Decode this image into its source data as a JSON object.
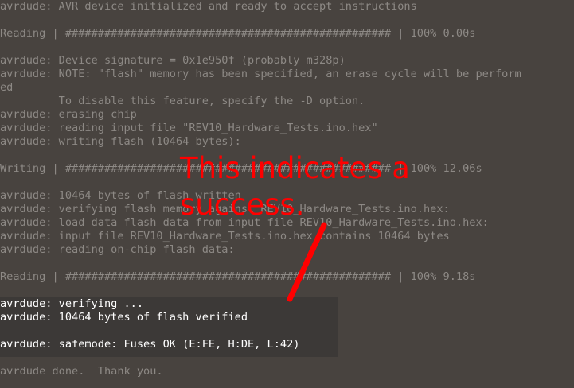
{
  "terminal": {
    "lines": [
      "avrdude: AVR device initialized and ready to accept instructions",
      "",
      "Reading | ################################################## | 100% 0.00s",
      "",
      "avrdude: Device signature = 0x1e950f (probably m328p)",
      "avrdude: NOTE: \"flash\" memory has been specified, an erase cycle will be perform",
      "ed",
      "         To disable this feature, specify the -D option.",
      "avrdude: erasing chip",
      "avrdude: reading input file \"REV10_Hardware_Tests.ino.hex\"",
      "avrdude: writing flash (10464 bytes):",
      "",
      "Writing | ################################################## | 100% 12.06s",
      "",
      "avrdude: 10464 bytes of flash written",
      "avrdude: verifying flash memory against REV10_Hardware_Tests.ino.hex:",
      "avrdude: load data flash data from input file REV10_Hardware_Tests.ino.hex:",
      "avrdude: input file REV10_Hardware_Tests.ino.hex contains 10464 bytes",
      "avrdude: reading on-chip flash data:",
      "",
      "Reading | ################################################## | 100% 9.18s",
      "",
      "avrdude: verifying ...",
      "avrdude: 10464 bytes of flash verified",
      "",
      "avrdude: safemode: Fuses OK (E:FE, H:DE, L:42)",
      "",
      "avrdude done.  Thank you."
    ]
  },
  "annotation": {
    "line1": "This indicates a",
    "line2": "success.",
    "color": "#ff0000"
  },
  "colors": {
    "background": "#48433f",
    "text": "#8d8985",
    "highlight_text": "#ffffff",
    "highlight_bg": "#3c3937"
  }
}
